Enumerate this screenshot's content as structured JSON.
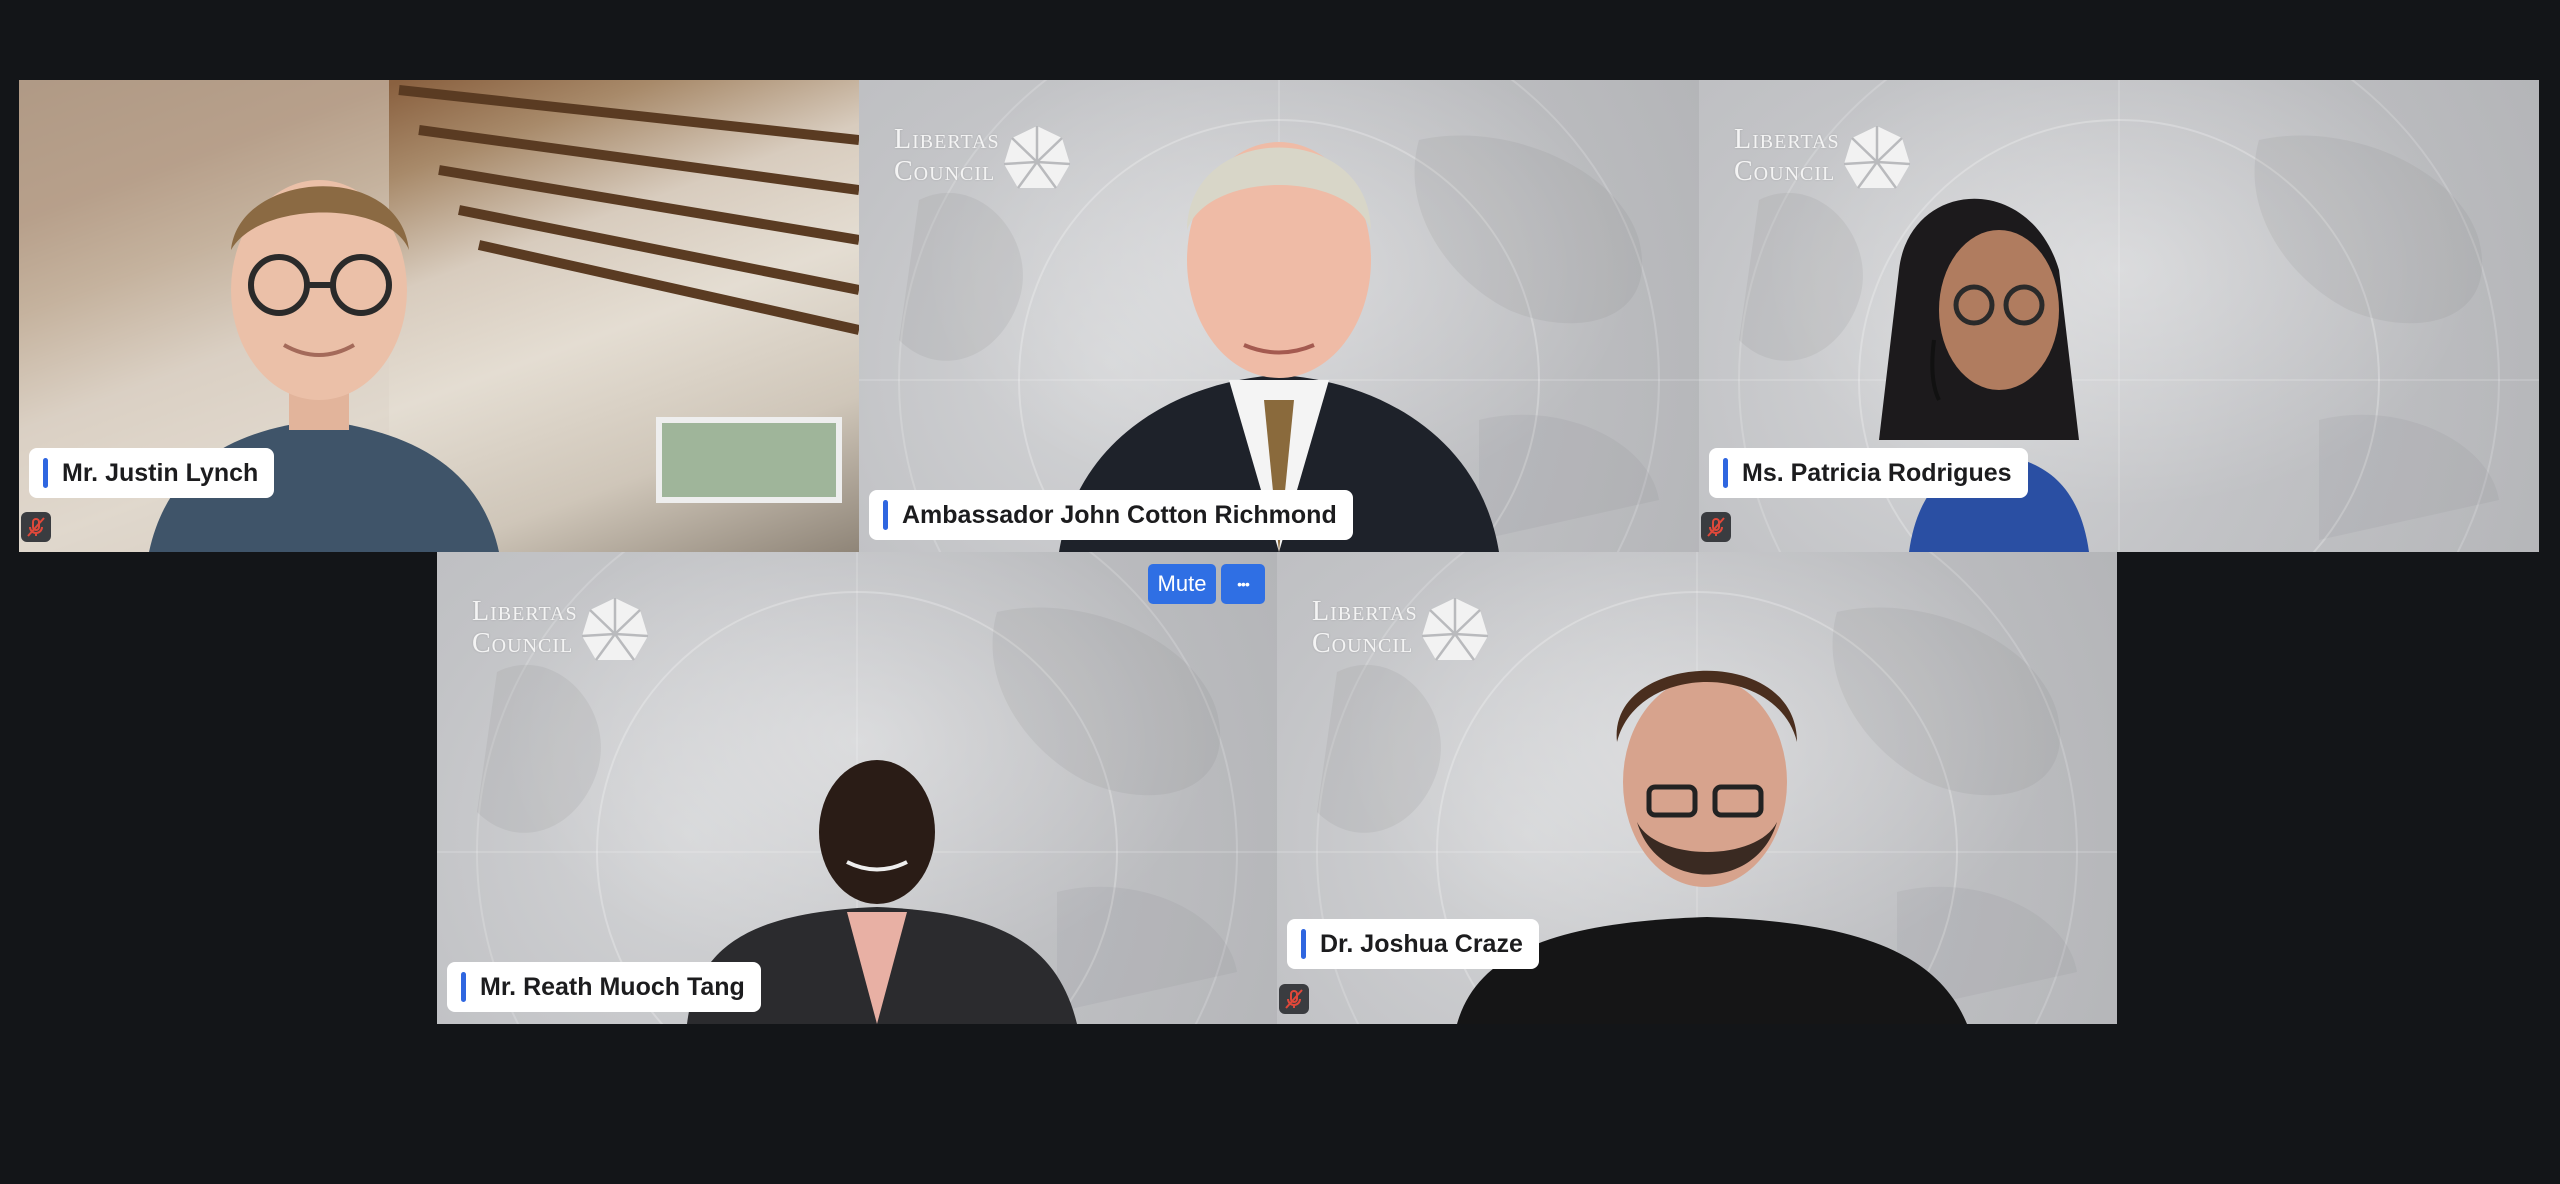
{
  "participants": [
    {
      "name": "Mr. Justin Lynch",
      "muted": true
    },
    {
      "name": "Ambassador John Cotton Richmond",
      "muted": false
    },
    {
      "name": "Ms. Patricia Rodrigues",
      "muted": true
    },
    {
      "name": "Mr. Reath Muoch Tang",
      "muted": false
    },
    {
      "name": "Dr. Joshua Craze",
      "muted": true
    }
  ],
  "logo": {
    "line1": "Libertas",
    "line2": "Council"
  },
  "controls": {
    "mute_label": "Mute",
    "more_label": "•••"
  },
  "colors": {
    "accent": "#2f6fe4",
    "nameplate_bar": "#2f66e0",
    "background": "#131518",
    "mic_muted": "#e0483a"
  },
  "icons": {
    "mic_off": "mic-off-icon",
    "more": "more-icon",
    "logo": "compass-star-icon"
  }
}
